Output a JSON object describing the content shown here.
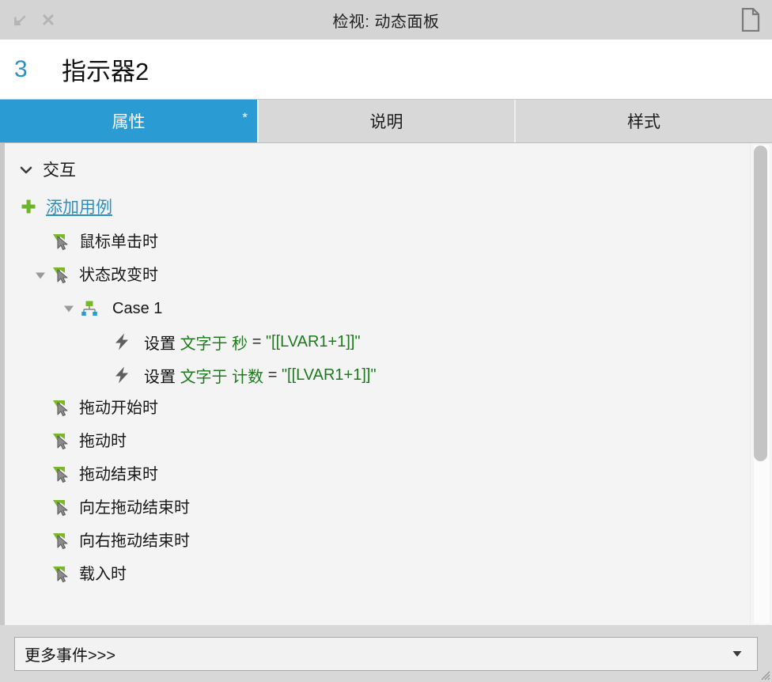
{
  "window": {
    "title": "检视: 动态面板",
    "minimize_icon": "arrow-down-left-icon",
    "close_icon": "close-icon",
    "document_icon": "document-icon"
  },
  "widget": {
    "index": "3",
    "name": "指示器2"
  },
  "tabs": [
    {
      "label": "属性",
      "active": true,
      "dirty_marker": "*"
    },
    {
      "label": "说明",
      "active": false,
      "dirty_marker": ""
    },
    {
      "label": "样式",
      "active": false,
      "dirty_marker": ""
    }
  ],
  "interactions": {
    "section_label": "交互",
    "section_disclosure": "chevron-down-icon",
    "add_case_label": "添加用例",
    "add_case_icon": "plus-icon",
    "events": [
      {
        "label": "鼠标单击时",
        "icon": "event-cursor-icon",
        "indent": 1,
        "expanded": false,
        "disclosure": ""
      },
      {
        "label": "状态改变时",
        "icon": "event-cursor-icon",
        "indent": 1,
        "expanded": true,
        "disclosure": "triangle-down-icon"
      },
      {
        "label": "Case 1",
        "icon": "case-node-icon",
        "indent": 2,
        "expanded": true,
        "disclosure": "triangle-down-icon"
      },
      {
        "label": "拖动开始时",
        "icon": "event-cursor-icon",
        "indent": 1,
        "expanded": false,
        "disclosure": ""
      },
      {
        "label": "拖动时",
        "icon": "event-cursor-icon",
        "indent": 1,
        "expanded": false,
        "disclosure": ""
      },
      {
        "label": "拖动结束时",
        "icon": "event-cursor-icon",
        "indent": 1,
        "expanded": false,
        "disclosure": ""
      },
      {
        "label": "向左拖动结束时",
        "icon": "event-cursor-icon",
        "indent": 1,
        "expanded": false,
        "disclosure": ""
      },
      {
        "label": "向右拖动结束时",
        "icon": "event-cursor-icon",
        "indent": 1,
        "expanded": false,
        "disclosure": ""
      },
      {
        "label": "载入时",
        "icon": "event-cursor-icon",
        "indent": 1,
        "expanded": false,
        "disclosure": ""
      }
    ],
    "actions": [
      {
        "icon": "lightning-icon",
        "verb": "设置",
        "target": "文字于 秒",
        "operator": "=",
        "value": "\"[[LVAR1+1]]\""
      },
      {
        "icon": "lightning-icon",
        "verb": "设置",
        "target": "文字于 计数",
        "operator": "=",
        "value": "\"[[LVAR1+1]]\""
      }
    ]
  },
  "footer": {
    "more_events_label": "更多事件>>>",
    "dropdown_icon": "triangle-down-icon",
    "resize_grip_icon": "resize-grip-icon"
  },
  "colors": {
    "accent": "#2b9bd4",
    "link": "#2a8fc4",
    "green": "#1d7a1d",
    "icon_green": "#7ab828",
    "icon_blue": "#2b9bd4",
    "titlebar_bg": "#d4d4d4",
    "content_bg": "#f4f4f4"
  },
  "scroll": {
    "vertical_position_percent": 0
  }
}
